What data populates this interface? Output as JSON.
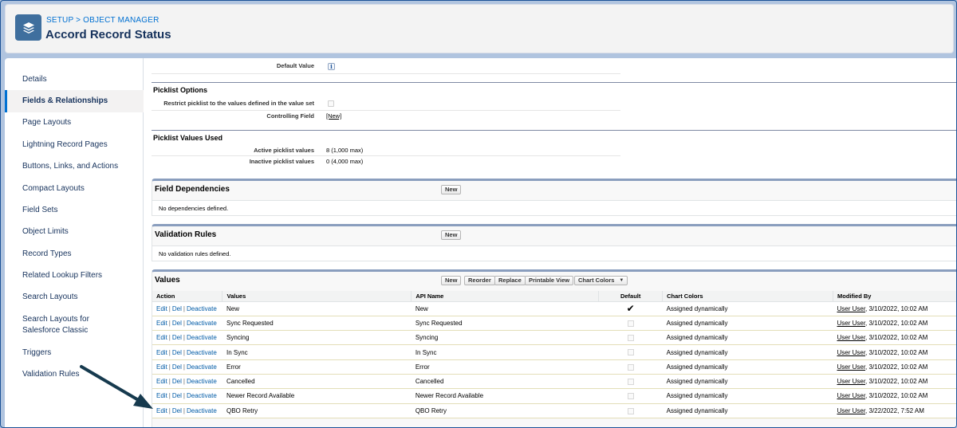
{
  "header": {
    "breadcrumb": "SETUP > OBJECT MANAGER",
    "title": "Accord Record Status",
    "icon": "layers-icon"
  },
  "sidebar": {
    "items": [
      {
        "label": "Details"
      },
      {
        "label": "Fields & Relationships"
      },
      {
        "label": "Page Layouts"
      },
      {
        "label": "Lightning Record Pages"
      },
      {
        "label": "Buttons, Links, and Actions"
      },
      {
        "label": "Compact Layouts"
      },
      {
        "label": "Field Sets"
      },
      {
        "label": "Object Limits"
      },
      {
        "label": "Record Types"
      },
      {
        "label": "Related Lookup Filters"
      },
      {
        "label": "Search Layouts"
      },
      {
        "label": "Search Layouts for Salesforce Classic"
      },
      {
        "label": "Triggers"
      },
      {
        "label": "Validation Rules"
      }
    ],
    "active_index": 1
  },
  "detail": {
    "default_value_label": "Default Value",
    "default_value_icon": "info-icon",
    "picklist_options": {
      "heading": "Picklist Options",
      "restrict_label": "Restrict picklist to the values defined in the value set",
      "controlling_label": "Controlling Field",
      "controlling_link": "[New]"
    },
    "picklist_values_used": {
      "heading": "Picklist Values Used",
      "active_label": "Active picklist values",
      "active_value": "8 (1,000 max)",
      "inactive_label": "Inactive picklist values",
      "inactive_value": "0 (4,000 max)"
    }
  },
  "field_dependencies": {
    "title": "Field Dependencies",
    "new_button": "New",
    "empty": "No dependencies defined."
  },
  "validation_rules": {
    "title": "Validation Rules",
    "new_button": "New",
    "empty": "No validation rules defined."
  },
  "values": {
    "title": "Values",
    "buttons": {
      "new": "New",
      "reorder": "Reorder",
      "replace": "Replace",
      "printable": "Printable View",
      "chart_colors": "Chart Colors"
    },
    "columns": [
      "Action",
      "Values",
      "API Name",
      "Default",
      "Chart Colors",
      "Modified By"
    ],
    "actions": {
      "edit": "Edit",
      "del": "Del",
      "deactivate": "Deactivate",
      "separator": "|"
    },
    "rows": [
      {
        "value": "New",
        "api_name": "New",
        "default": true,
        "chart_colors": "Assigned dynamically",
        "modified_user": "User User",
        "modified_date": ", 3/10/2022, 10:02 AM"
      },
      {
        "value": "Sync Requested",
        "api_name": "Sync Requested",
        "default": false,
        "chart_colors": "Assigned dynamically",
        "modified_user": "User User",
        "modified_date": ", 3/10/2022, 10:02 AM"
      },
      {
        "value": "Syncing",
        "api_name": "Syncing",
        "default": false,
        "chart_colors": "Assigned dynamically",
        "modified_user": "User User",
        "modified_date": ", 3/10/2022, 10:02 AM"
      },
      {
        "value": "In Sync",
        "api_name": "In Sync",
        "default": false,
        "chart_colors": "Assigned dynamically",
        "modified_user": "User User",
        "modified_date": ", 3/10/2022, 10:02 AM"
      },
      {
        "value": "Error",
        "api_name": "Error",
        "default": false,
        "chart_colors": "Assigned dynamically",
        "modified_user": "User User",
        "modified_date": ", 3/10/2022, 10:02 AM"
      },
      {
        "value": "Cancelled",
        "api_name": "Cancelled",
        "default": false,
        "chart_colors": "Assigned dynamically",
        "modified_user": "User User",
        "modified_date": ", 3/10/2022, 10:02 AM"
      },
      {
        "value": "Newer Record Available",
        "api_name": "Newer Record Available",
        "default": false,
        "chart_colors": "Assigned dynamically",
        "modified_user": "User User",
        "modified_date": ", 3/10/2022, 10:02 AM"
      },
      {
        "value": "QBO Retry",
        "api_name": "QBO Retry",
        "default": false,
        "chart_colors": "Assigned dynamically",
        "modified_user": "User User",
        "modified_date": ", 3/22/2022, 7:52 AM"
      }
    ]
  },
  "colors": {
    "link": "#015ba7",
    "accent": "#0070d2",
    "title": "#16325c",
    "arrow": "#163a4e"
  }
}
